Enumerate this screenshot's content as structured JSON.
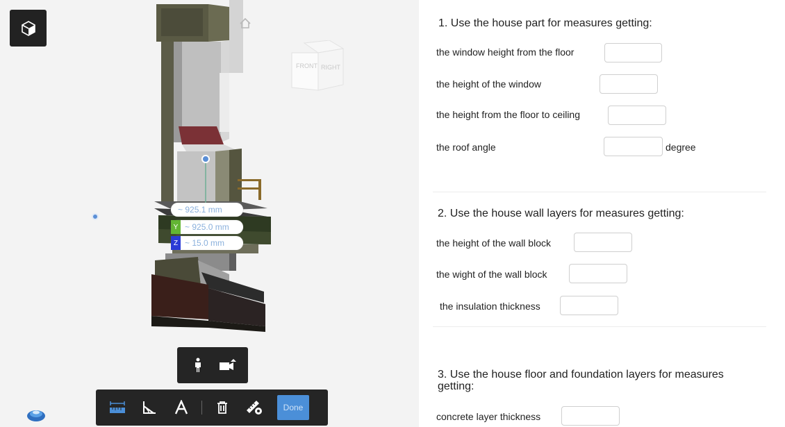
{
  "viewer": {
    "measurements": [
      {
        "axis": "",
        "value": "~ 925.1 mm"
      },
      {
        "axis": "Y",
        "value": "~ 925.0 mm"
      },
      {
        "axis": "Z",
        "value": "~ 15.0 mm"
      }
    ],
    "axis_colors": {
      "Y": "#63b534",
      "Z": "#2b3bd6"
    },
    "viewcube": {
      "front_label": "FRONT",
      "right_label": "RIGHT"
    },
    "icons": {
      "view_mode": "cube-icon",
      "home": "home-icon",
      "walk": "person-icon",
      "camera": "video-camera-icon",
      "distance": "ruler-icon",
      "angle": "angle-icon",
      "area": "area-icon",
      "delete": "trash-icon",
      "settings": "ruler-gear-icon",
      "logo": "bim-logo-icon"
    },
    "done_label": "Done"
  },
  "form": {
    "sections": [
      {
        "title": "1. Use the house part for measures getting:",
        "rows": [
          {
            "label": "the window height from the floor",
            "value": "",
            "unit": ""
          },
          {
            "label": "the height of the window",
            "value": "",
            "unit": ""
          },
          {
            "label": "the height from the floor to ceiling",
            "value": "",
            "unit": ""
          },
          {
            "label": "the roof angle",
            "value": "",
            "unit": "degree"
          }
        ]
      },
      {
        "title": "2. Use the house wall layers for measures getting:",
        "rows": [
          {
            "label": "the height of the wall block",
            "value": ""
          },
          {
            "label": "the wight of the wall block",
            "value": ""
          },
          {
            "label": "the insulation thickness",
            "value": ""
          }
        ]
      },
      {
        "title_line1": "3. Use the house floor and foundation layers for measures",
        "title_line2": "getting:",
        "rows": [
          {
            "label": "concrete layer thickness",
            "value": ""
          }
        ]
      }
    ]
  }
}
